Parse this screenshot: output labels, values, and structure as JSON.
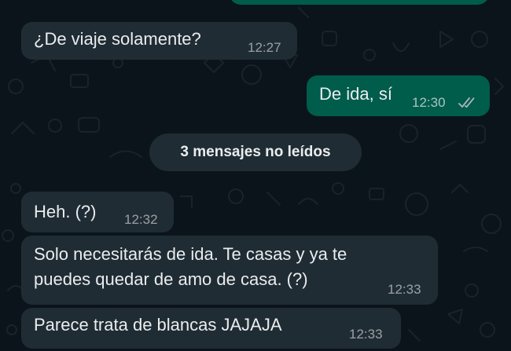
{
  "chat": {
    "unread_divider": "3 mensajes no leídos",
    "messages": [
      {
        "direction": "incoming",
        "text": "¿De viaje solamente?",
        "time": "12:27"
      },
      {
        "direction": "outgoing",
        "text": "De ida, sí",
        "time": "12:30",
        "status": "read",
        "status_icon": "double-check-icon"
      },
      {
        "direction": "incoming",
        "text": "Heh. (?)",
        "time": "12:32"
      },
      {
        "direction": "incoming",
        "lines": [
          "Solo necesitarás de ida. Te casas y ya te",
          "puedes quedar de amo de casa. (?)"
        ],
        "time": "12:33"
      },
      {
        "direction": "incoming",
        "text": "Parece trata de blancas JAJAJA",
        "time": "12:33"
      }
    ]
  },
  "colors": {
    "background": "#0b141a",
    "incoming_bubble": "#202c33",
    "outgoing_bubble": "#005c4b",
    "text": "#e9edef"
  }
}
